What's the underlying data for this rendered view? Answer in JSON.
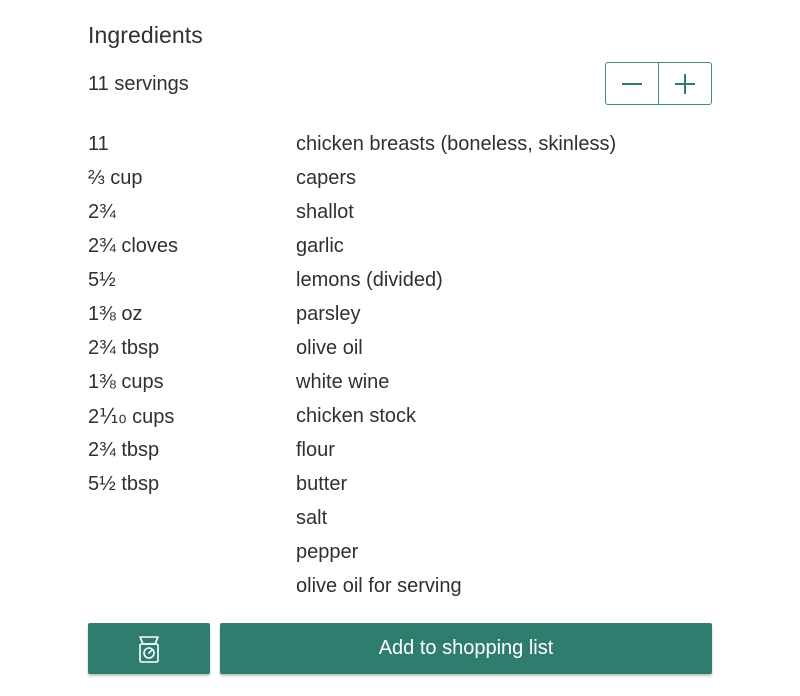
{
  "section": {
    "title": "Ingredients",
    "servings_label": "11 servings"
  },
  "servings_stepper": {
    "decrease_icon": "minus-icon",
    "increase_icon": "plus-icon"
  },
  "ingredients": [
    {
      "qty": "11",
      "name": "chicken breasts (boneless, skinless)"
    },
    {
      "qty": "⅔ cup",
      "name": "capers"
    },
    {
      "qty": "2¾",
      "name": "shallot"
    },
    {
      "qty": "2¾ cloves",
      "name": "garlic"
    },
    {
      "qty": "5½",
      "name": "lemons (divided)"
    },
    {
      "qty": "1⅜ oz",
      "name": "parsley"
    },
    {
      "qty": "2¾ tbsp",
      "name": "olive oil"
    },
    {
      "qty": "1⅜ cups",
      "name": "white wine"
    },
    {
      "qty": "2⅒ cups",
      "name": "chicken stock"
    },
    {
      "qty": "2¾ tbsp",
      "name": "flour"
    },
    {
      "qty": "5½ tbsp",
      "name": "butter"
    },
    {
      "qty": "",
      "name": "salt"
    },
    {
      "qty": "",
      "name": "pepper"
    },
    {
      "qty": "",
      "name": "olive oil for serving"
    }
  ],
  "actions": {
    "scale_icon": "kitchen-scale-icon",
    "add_to_list_label": "Add to shopping list"
  },
  "colors": {
    "accent": "#2e7d6f",
    "stepper_border": "#3b8a7d",
    "text": "#303030",
    "button_text": "#ffffff"
  }
}
